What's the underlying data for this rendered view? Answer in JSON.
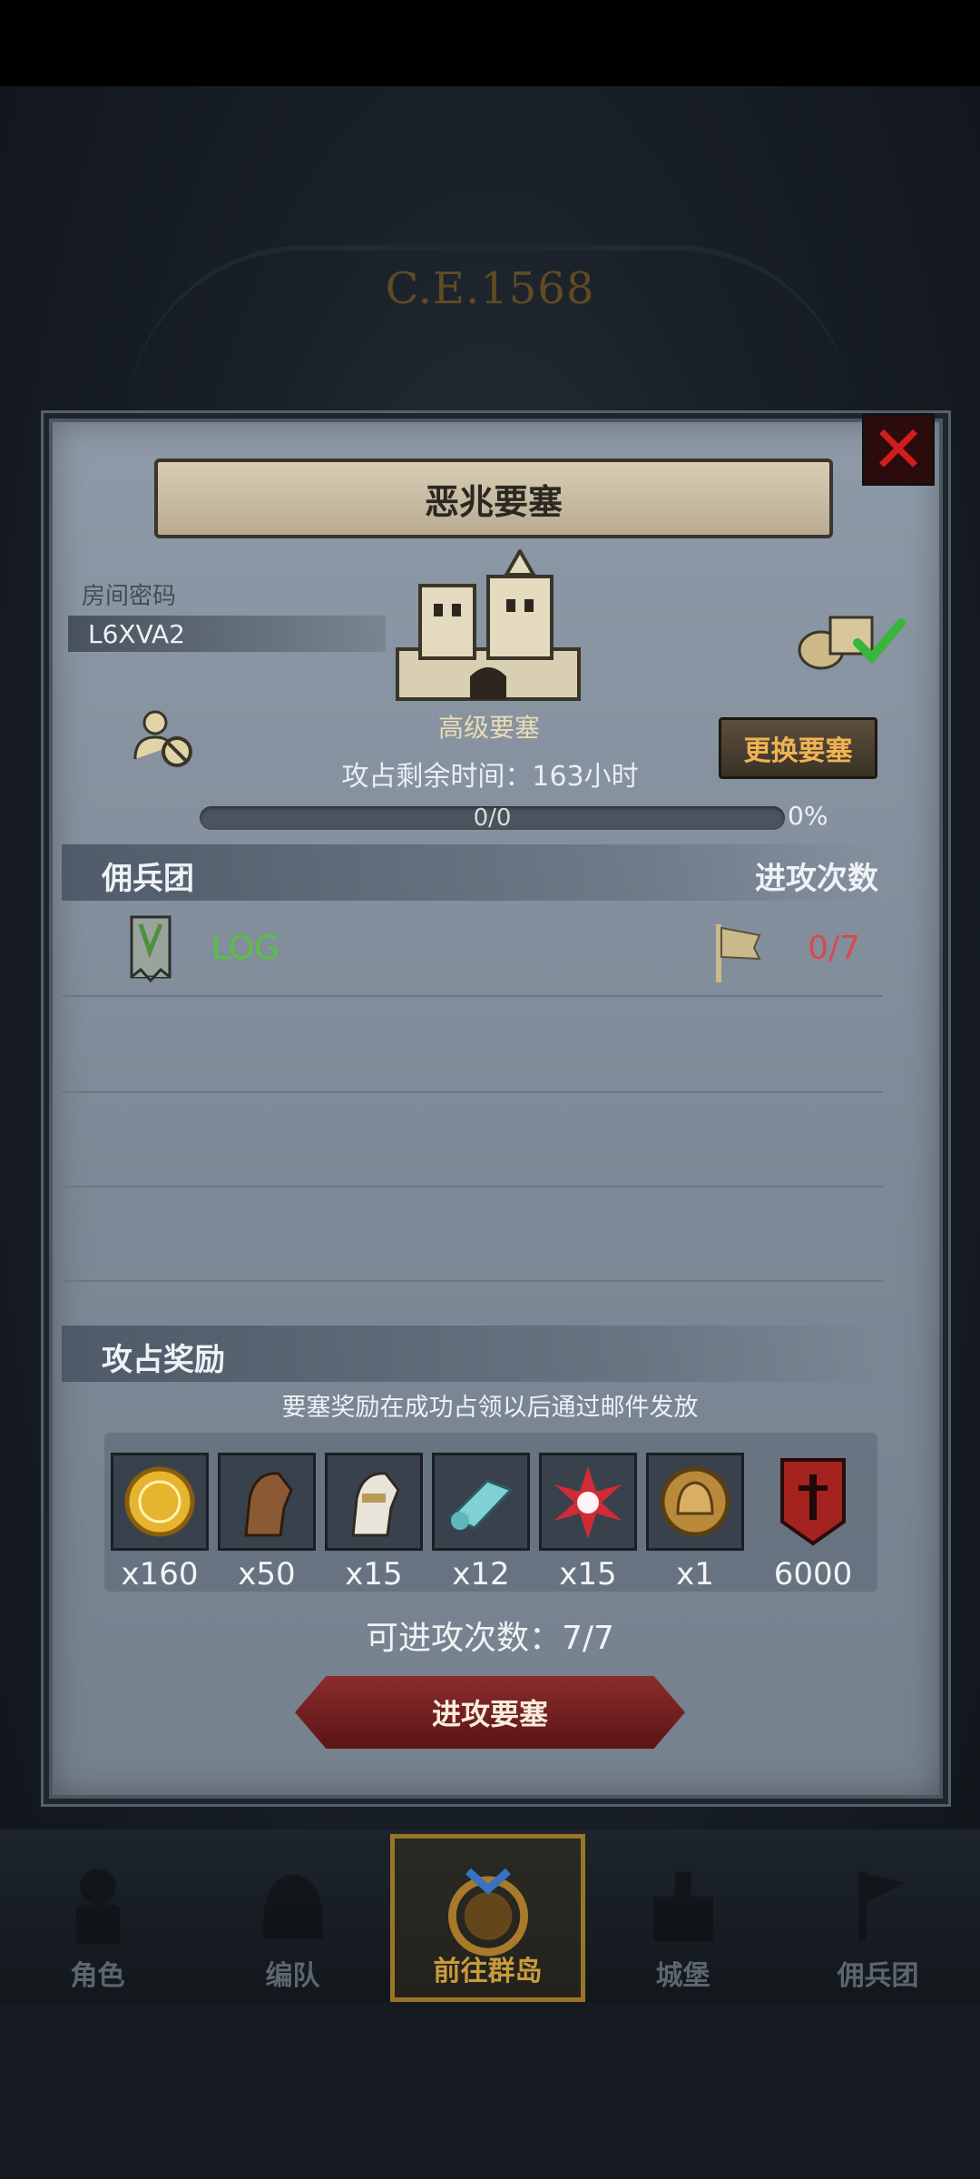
{
  "background": {
    "era": "C.E.1568"
  },
  "dialog": {
    "title": "恶兆要塞",
    "room_label": "房间密码",
    "room_code": "L6XVA2",
    "fortress_grade": "高级要塞",
    "change_button": "更换要塞",
    "time_label": "攻占剩余时间：163小时",
    "progress": {
      "text": "0/0",
      "percent_text": "0%",
      "fraction": 0
    },
    "guild_header": "佣兵团",
    "attack_header": "进攻次数",
    "guild_row": {
      "name": "LOG",
      "count": "0/7"
    },
    "reward_header": "攻占奖励",
    "reward_notice": "要塞奖励在成功占领以后通过邮件发放",
    "rewards": [
      {
        "icon": "gold-coin-icon",
        "qty": "x160"
      },
      {
        "icon": "brown-horse-icon",
        "qty": "x50"
      },
      {
        "icon": "armored-horse-icon",
        "qty": "x15"
      },
      {
        "icon": "cloth-roll-icon",
        "qty": "x12"
      },
      {
        "icon": "red-star-icon",
        "qty": "x15"
      },
      {
        "icon": "helmet-medal-icon",
        "qty": "x1"
      },
      {
        "icon": "guild-banner-icon",
        "qty": "6000"
      }
    ],
    "remaining_attacks": "可进攻次数：7/7",
    "attack_button": "进攻要塞"
  },
  "nav": [
    {
      "label": "角色",
      "active": false
    },
    {
      "label": "编队",
      "active": false
    },
    {
      "label": "前往群岛",
      "active": true
    },
    {
      "label": "城堡",
      "active": false
    },
    {
      "label": "佣兵团",
      "active": false
    }
  ],
  "colors": {
    "accent": "#c89b3c",
    "guild_name": "#56c241",
    "count_red": "#d84a4a",
    "close": "#d11d1d"
  }
}
